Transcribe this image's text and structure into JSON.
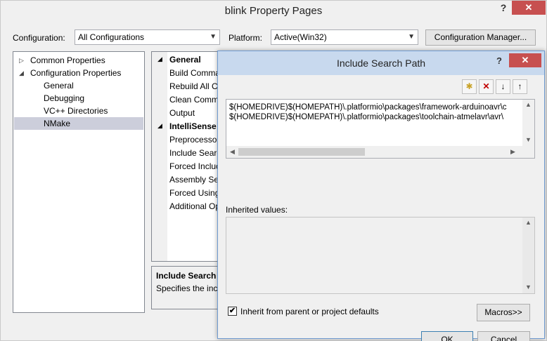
{
  "window": {
    "title": "blink Property Pages",
    "help": "?",
    "close": "✕"
  },
  "config_bar": {
    "configuration_label": "Configuration:",
    "configuration_value": "All Configurations",
    "platform_label": "Platform:",
    "platform_value": "Active(Win32)",
    "manager_button": "Configuration Manager..."
  },
  "tree": {
    "items": [
      {
        "label": "Common Properties",
        "expander": "▷"
      },
      {
        "label": "Configuration Properties",
        "expander": "◢"
      },
      {
        "label": "General"
      },
      {
        "label": "Debugging"
      },
      {
        "label": "VC++ Directories"
      },
      {
        "label": "NMake",
        "selected": true
      }
    ]
  },
  "grid": {
    "rows": [
      {
        "label": "General",
        "category": true
      },
      {
        "label": "Build Comma"
      },
      {
        "label": "Rebuild All C"
      },
      {
        "label": "Clean Comm"
      },
      {
        "label": "Output"
      },
      {
        "label": "IntelliSense",
        "category": true
      },
      {
        "label": "Preprocessor"
      },
      {
        "label": "Include Searc"
      },
      {
        "label": "Forced Incluc"
      },
      {
        "label": "Assembly Sea"
      },
      {
        "label": "Forced Using"
      },
      {
        "label": "Additional Op"
      }
    ],
    "caret": "◢"
  },
  "description": {
    "title": "Include Search P",
    "text": "Specifies the incl"
  },
  "dialog": {
    "title": "Include Search Path",
    "help": "?",
    "close": "✕",
    "toolbar": {
      "new_line": "✱",
      "delete": "✕",
      "move_down": "↓",
      "move_up": "↑"
    },
    "lines": [
      "$(HOMEDRIVE)$(HOMEPATH)\\.platformio\\packages\\framework-arduinoavr\\c",
      "$(HOMEDRIVE)$(HOMEPATH)\\.platformio\\packages\\toolchain-atmelavr\\avr\\"
    ],
    "inherited_label": "Inherited values:",
    "inherit_checkbox_label": "Inherit from parent or project defaults",
    "inherit_checked": true,
    "check_mark": "✔",
    "macros_button": "Macros>>",
    "ok_button": "OK",
    "cancel_button": "Cancel"
  },
  "colors": {
    "accent": "#c8d9ee",
    "close_red": "#c75050",
    "selection": "#cccedb"
  }
}
